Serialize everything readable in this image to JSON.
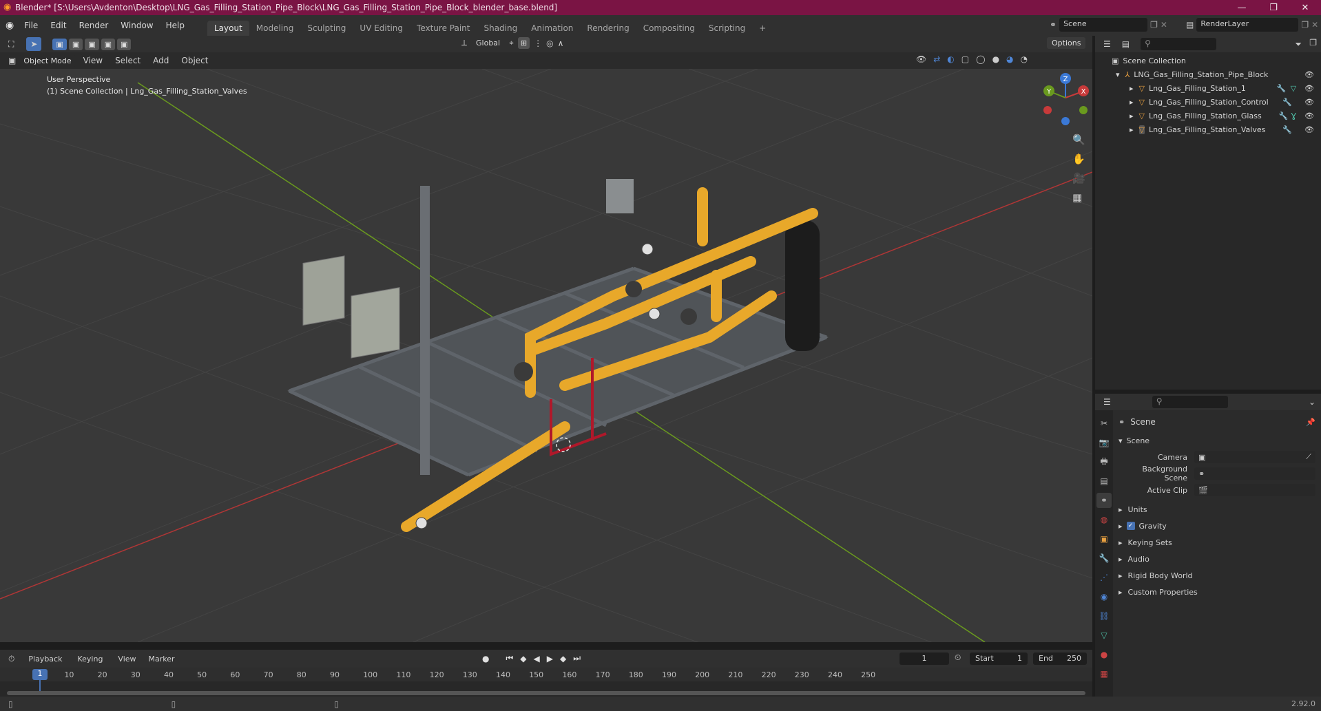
{
  "window": {
    "title": "Blender* [S:\\Users\\Avdenton\\Desktop\\LNG_Gas_Filling_Station_Pipe_Block\\LNG_Gas_Filling_Station_Pipe_Block_blender_base.blend]",
    "minimize": "—",
    "maximize": "❐",
    "close": "✕"
  },
  "menu": [
    "File",
    "Edit",
    "Render",
    "Window",
    "Help"
  ],
  "workspaces": [
    "Layout",
    "Modeling",
    "Sculpting",
    "UV Editing",
    "Texture Paint",
    "Shading",
    "Animation",
    "Rendering",
    "Compositing",
    "Scripting"
  ],
  "workspace_add": "+",
  "scene_selector": "Scene",
  "renderlayer_selector": "RenderLayer",
  "viewport": {
    "mode": "Object Mode",
    "header_menus": [
      "View",
      "Select",
      "Add",
      "Object"
    ],
    "transform_orientation": "Global",
    "options": "Options",
    "overlay_title": "User Perspective",
    "overlay_subtitle": "(1) Scene Collection | Lng_Gas_Filling_Station_Valves",
    "gizmo": {
      "x": "X",
      "y": "Y",
      "z": "Z"
    }
  },
  "outliner": {
    "root": "Scene Collection",
    "collection": "LNG_Gas_Filling_Station_Pipe_Block",
    "objects": [
      "Lng_Gas_Filling_Station_1",
      "Lng_Gas_Filling_Station_Control",
      "Lng_Gas_Filling_Station_Glass",
      "Lng_Gas_Filling_Station_Valves"
    ]
  },
  "properties": {
    "context": "Scene",
    "panel": "Scene",
    "fields": [
      {
        "label": "Camera",
        "value": ""
      },
      {
        "label": "Background Scene",
        "value": ""
      },
      {
        "label": "Active Clip",
        "value": ""
      }
    ],
    "subpanels": [
      "Units",
      "Gravity",
      "Keying Sets",
      "Audio",
      "Rigid Body World",
      "Custom Properties"
    ],
    "gravity_checked": true
  },
  "timeline": {
    "menus": [
      "Playback",
      "Keying",
      "View",
      "Marker"
    ],
    "current_frame": "1",
    "start_label": "Start",
    "start": "1",
    "end_label": "End",
    "end": "250",
    "ruler": [
      "1",
      "10",
      "20",
      "30",
      "40",
      "50",
      "60",
      "70",
      "80",
      "90",
      "100",
      "110",
      "120",
      "130",
      "140",
      "150",
      "160",
      "170",
      "180",
      "190",
      "200",
      "210",
      "220",
      "230",
      "240",
      "250"
    ]
  },
  "status": {
    "version": "2.92.0"
  },
  "colors": {
    "title_bar": "#7a1444",
    "accent": "#4772b3",
    "pipe": "#e8a82a",
    "x_axis": "#c83a3a",
    "y_axis": "#6a9a1e"
  }
}
